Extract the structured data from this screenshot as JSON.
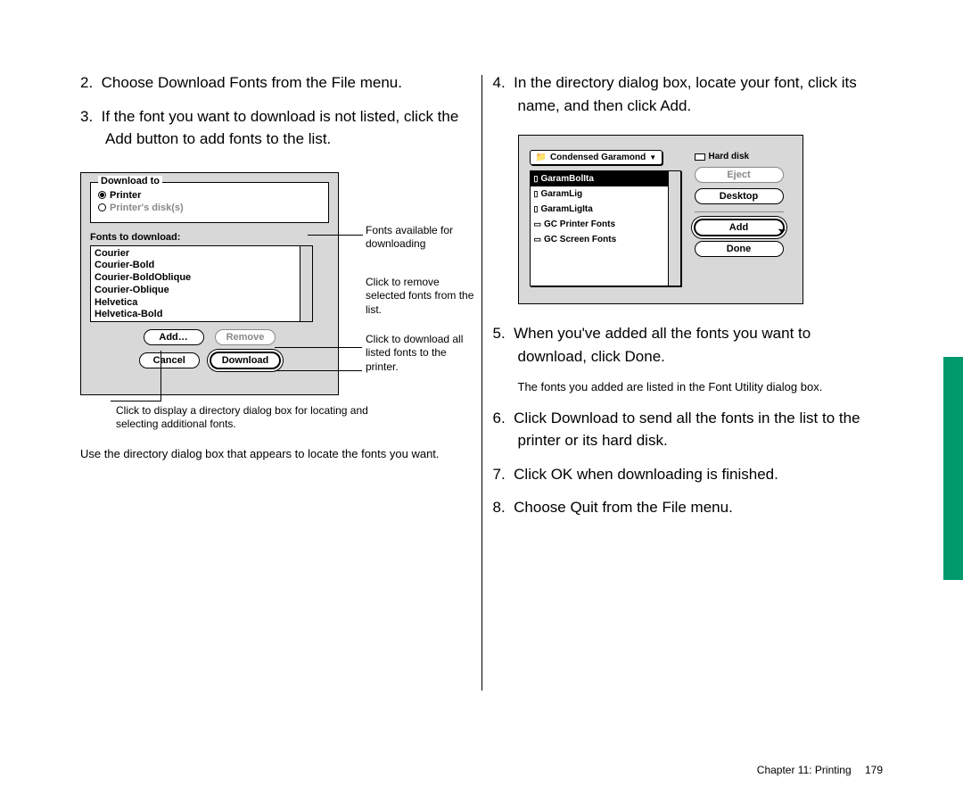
{
  "left_steps": [
    {
      "n": "2.",
      "t": "Choose Download Fonts from the File menu."
    },
    {
      "n": "3.",
      "t": "If the font you want to download is not listed, click the Add button to add fonts to the list."
    }
  ],
  "left_follow": "Use the directory dialog box that appears to locate the fonts you want.",
  "fig1": {
    "group_title": "Download to",
    "radio_printer": "Printer",
    "radio_disks": "Printer's disk(s)",
    "list_label": "Fonts to download:",
    "fonts": [
      "Courier",
      "Courier-Bold",
      "Courier-BoldOblique",
      "Courier-Oblique",
      "Helvetica",
      "Helvetica-Bold"
    ],
    "btn_add": "Add…",
    "btn_remove": "Remove",
    "btn_cancel": "Cancel",
    "btn_download": "Download",
    "callout_r1": "Fonts available for downloading",
    "callout_r2": "Click to remove selected fonts from the list.",
    "callout_r3": "Click to download all listed fonts to the printer.",
    "callout_b": "Click to display a directory dialog box for locating and selecting additional fonts."
  },
  "right_steps_a": [
    {
      "n": "4.",
      "t": "In the directory dialog box, locate your font, click its name, and then click Add."
    }
  ],
  "fig2": {
    "drop": "Condensed Garamond",
    "items": [
      {
        "kind": "d",
        "label": "GaramBolIta",
        "sel": true
      },
      {
        "kind": "d",
        "label": "GaramLig"
      },
      {
        "kind": "d",
        "label": "GaramLigIta"
      },
      {
        "kind": "f",
        "label": "GC Printer Fonts"
      },
      {
        "kind": "f",
        "label": "GC Screen Fonts"
      }
    ],
    "hd": "Hard disk",
    "btn_eject": "Eject",
    "btn_desktop": "Desktop",
    "btn_add": "Add",
    "btn_done": "Done"
  },
  "right_steps_b": [
    {
      "n": "5.",
      "t": "When you've added all the fonts you want to download, click Done."
    }
  ],
  "right_note": "The fonts you added are listed in the Font Utility dialog box.",
  "right_steps_c": [
    {
      "n": "6.",
      "t": "Click Download to send all the fonts in the list to the printer or its hard disk."
    },
    {
      "n": "7.",
      "t": "Click OK when downloading is finished."
    },
    {
      "n": "8.",
      "t": "Choose Quit from the File menu."
    }
  ],
  "footer": {
    "chapter": "Chapter 11: Printing",
    "page": "179"
  }
}
